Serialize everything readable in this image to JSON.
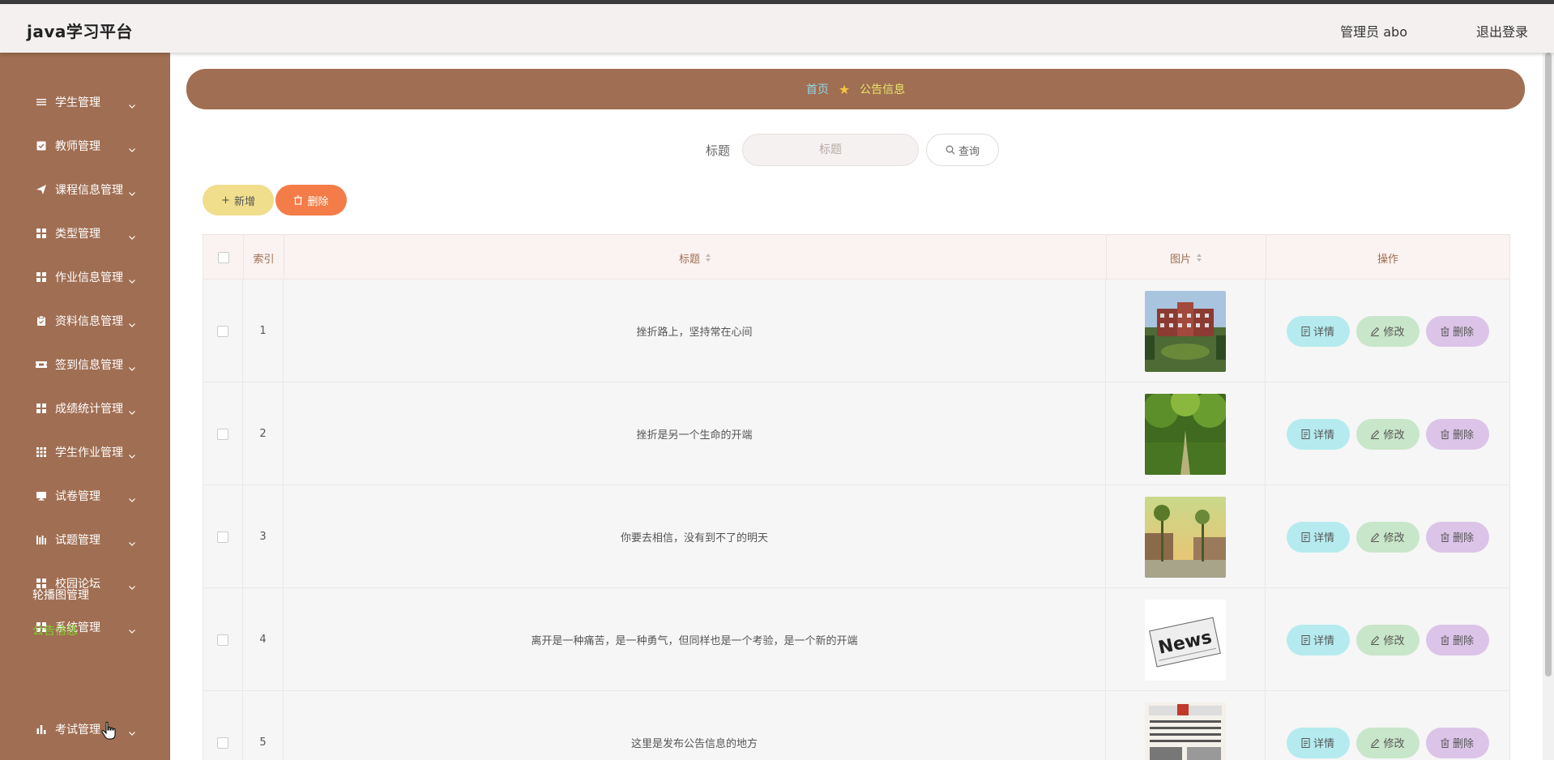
{
  "header": {
    "app_title": "java学习平台",
    "admin_label": "管理员 abo",
    "logout_label": "退出登录"
  },
  "sidebar": {
    "menus": [
      {
        "label": "学生管理",
        "icon": "list-icon"
      },
      {
        "label": "教师管理",
        "icon": "check-square-icon"
      },
      {
        "label": "课程信息管理",
        "icon": "send-icon"
      },
      {
        "label": "类型管理",
        "icon": "grid-icon"
      },
      {
        "label": "作业信息管理",
        "icon": "grid-icon"
      },
      {
        "label": "资料信息管理",
        "icon": "clipboard-icon"
      },
      {
        "label": "签到信息管理",
        "icon": "ticket-icon"
      },
      {
        "label": "成绩统计管理",
        "icon": "grid-icon"
      },
      {
        "label": "学生作业管理",
        "icon": "grid-small-icon"
      },
      {
        "label": "试卷管理",
        "icon": "monitor-icon"
      },
      {
        "label": "试题管理",
        "icon": "bars-icon"
      },
      {
        "label": "校园论坛",
        "icon": "grid-icon"
      },
      {
        "label": "系统管理",
        "icon": "grid-icon"
      }
    ],
    "sub_items": [
      {
        "label": "轮播图管理",
        "active": false
      },
      {
        "label": "公告信息",
        "active": true
      }
    ],
    "bottom_menu": {
      "label": "考试管理",
      "icon": "bar-chart-icon"
    },
    "active_color": "#7fd32f",
    "bg_color": "#a06e52"
  },
  "breadcrumb": {
    "home": "首页",
    "current": "公告信息"
  },
  "search": {
    "label": "标题",
    "placeholder": "标题",
    "value": "",
    "button_label": "查询"
  },
  "toolbar": {
    "add_label": "新增",
    "delete_label": "删除"
  },
  "table": {
    "headers": {
      "index": "索引",
      "title": "标题",
      "image": "图片",
      "actions": "操作"
    },
    "rows": [
      {
        "index": "1",
        "title": "挫折路上，坚持常在心间",
        "image": "campus-building"
      },
      {
        "index": "2",
        "title": "挫折是另一个生命的开端",
        "image": "tree-path"
      },
      {
        "index": "3",
        "title": "你要去相信，没有到不了的明天",
        "image": "sunset-street"
      },
      {
        "index": "4",
        "title": "离开是一种痛苦，是一种勇气，但同样也是一个考验，是一个新的开端",
        "image": "news-paper"
      },
      {
        "index": "5",
        "title": "这里是发布公告信息的地方",
        "image": "newspaper-page"
      }
    ],
    "action_labels": {
      "detail": "详情",
      "edit": "修改",
      "delete": "删除"
    }
  }
}
